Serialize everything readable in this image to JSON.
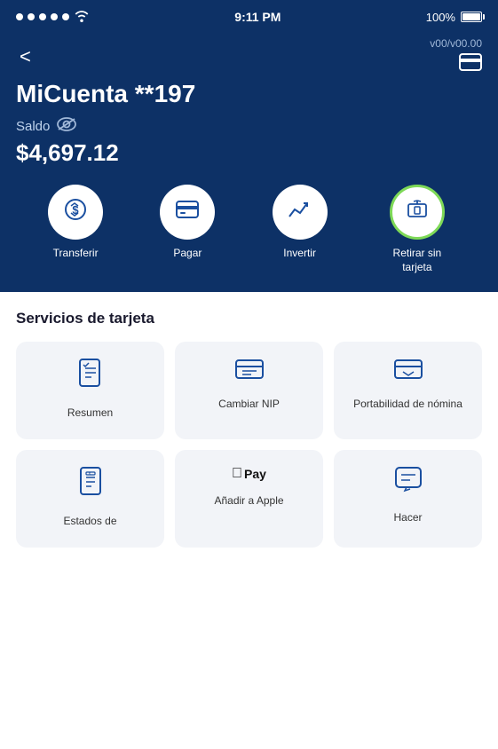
{
  "statusBar": {
    "time": "9:11 PM",
    "batteryPct": "100%",
    "signalDots": 5
  },
  "header": {
    "backLabel": "<",
    "balanceHidden": "v00/v00.00",
    "accountTitle": "MiCuenta **197",
    "balanceLabel": "Saldo",
    "balanceAmount": "$4,697.12"
  },
  "actions": [
    {
      "id": "transferir",
      "label": "Transferir",
      "icon": "↻$",
      "highlighted": false
    },
    {
      "id": "pagar",
      "label": "Pagar",
      "icon": "💳",
      "highlighted": false
    },
    {
      "id": "invertir",
      "label": "Invertir",
      "icon": "📈",
      "highlighted": false
    },
    {
      "id": "retirar",
      "label": "Retirar sin tarjeta",
      "icon": "🏧",
      "highlighted": true
    }
  ],
  "serviciosTitle": "Servicios de tarjeta",
  "serviceCards": [
    {
      "id": "resumen",
      "label": "Resumen",
      "iconType": "clipboard"
    },
    {
      "id": "cambiar-nip",
      "label": "Cambiar NIP",
      "iconType": "card-lines"
    },
    {
      "id": "portabilidad",
      "label": "Portabilidad de nómina",
      "iconType": "card-arrow"
    },
    {
      "id": "estados",
      "label": "Estados de",
      "iconType": "receipt"
    },
    {
      "id": "apple-pay",
      "label": "Añadir a Apple",
      "iconType": "applepay"
    },
    {
      "id": "hacer",
      "label": "Hacer",
      "iconType": "chat-card"
    }
  ]
}
